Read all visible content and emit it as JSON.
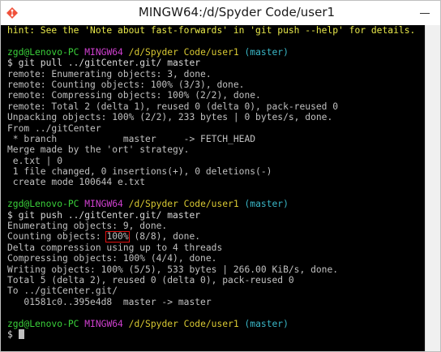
{
  "window": {
    "title": "MINGW64:/d/Spyder Code/user1"
  },
  "icons": {
    "app": "git-bash-icon",
    "minimize": "minimize-icon"
  },
  "colors": {
    "background": "#000000",
    "text": "#c0c0c0",
    "hint": "#e8e84a",
    "user_host": "#3ad03a",
    "shell": "#d040d0",
    "path": "#d8c832",
    "branch": "#3ab8c8",
    "highlight_box": "#e01010"
  },
  "terminal": {
    "hint_line": "hint: See the 'Note about fast-forwards' in 'git push --help' for details.",
    "prompt1": {
      "user_host": "zgd@Lenovo-PC",
      "shell": "MINGW64",
      "path": "/d/Spyder Code/user1",
      "branch": "(master)"
    },
    "cmd1": "$ git pull ../gitCenter.git/ master",
    "pull_output": [
      "remote: Enumerating objects: 3, done.",
      "remote: Counting objects: 100% (3/3), done.",
      "remote: Compressing objects: 100% (2/2), done.",
      "remote: Total 2 (delta 1), reused 0 (delta 0), pack-reused 0",
      "Unpacking objects: 100% (2/2), 233 bytes | 0 bytes/s, done.",
      "From ../gitCenter",
      " * branch            master     -> FETCH_HEAD",
      "Merge made by the 'ort' strategy.",
      " e.txt | 0",
      " 1 file changed, 0 insertions(+), 0 deletions(-)",
      " create mode 100644 e.txt"
    ],
    "prompt2": {
      "user_host": "zgd@Lenovo-PC",
      "shell": "MINGW64",
      "path": "/d/Spyder Code/user1",
      "branch": "(master)"
    },
    "cmd2": "$ git push ../gitCenter.git/ master",
    "push_line1": "Enumerating objects: 9, done.",
    "push_counting_prefix": "Counting objects: ",
    "push_counting_highlight": "100%",
    "push_counting_suffix": " (8/8), done.",
    "push_output": [
      "Delta compression using up to 4 threads",
      "Compressing objects: 100% (4/4), done.",
      "Writing objects: 100% (5/5), 533 bytes | 266.00 KiB/s, done.",
      "Total 5 (delta 2), reused 0 (delta 0), pack-reused 0",
      "To ../gitCenter.git/",
      "   01581c0..395e4d8  master -> master"
    ],
    "prompt3": {
      "user_host": "zgd@Lenovo-PC",
      "shell": "MINGW64",
      "path": "/d/Spyder Code/user1",
      "branch": "(master)"
    },
    "cmd3": "$ "
  }
}
